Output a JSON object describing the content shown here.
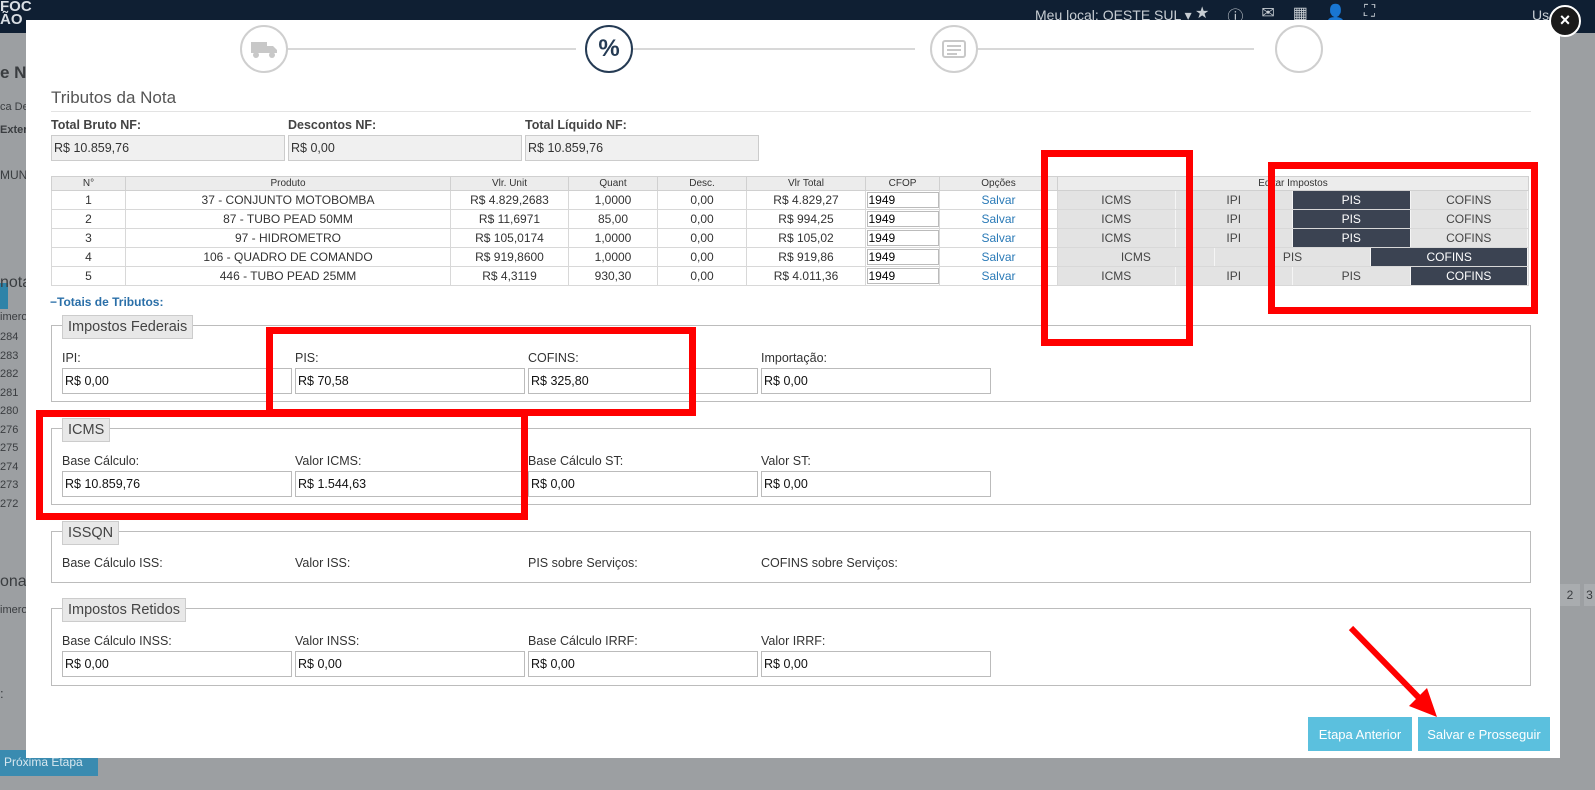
{
  "bg": {
    "logo_line1": "FOC",
    "logo_line2": "ÃO",
    "local": "Meu local: OESTE SUL",
    "user": "Us",
    "heading": "e N",
    "side1": "ca De",
    "side2": "Exter",
    "side3": "MUN",
    "side4": "nota",
    "col_header": "imero",
    "rows": [
      "284",
      "283",
      "282",
      "281",
      "280",
      "276",
      "275",
      "274",
      "273",
      "272"
    ],
    "section": "ona",
    "col_header2": "imero",
    "colon": ":",
    "next_step": "Próxima Etapa",
    "page2": "2",
    "page3": "3"
  },
  "modal": {
    "title": "Tributos da Nota",
    "total_bruto_label": "Total Bruto NF:",
    "total_bruto": "R$ 10.859,76",
    "descontos_label": "Descontos NF:",
    "descontos": "R$ 0,00",
    "total_liquido_label": "Total Líquido NF:",
    "total_liquido": "R$ 10.859,76",
    "table": {
      "headers": [
        "N°",
        "Produto",
        "Vlr. Unit",
        "Quant",
        "Desc.",
        "Vlr Total",
        "CFOP",
        "Opções",
        "Editar Impostos"
      ],
      "rows": [
        {
          "n": "1",
          "produto": "37 - CONJUNTO MOTOBOMBA",
          "unit": "R$ 4.829,2683",
          "quant": "1,0000",
          "desc": "0,00",
          "total": "R$ 4.829,27",
          "cfop": "1949",
          "opcao": "Salvar"
        },
        {
          "n": "2",
          "produto": "87 - TUBO PEAD 50MM",
          "unit": "R$ 11,6971",
          "quant": "85,00",
          "desc": "0,00",
          "total": "R$ 994,25",
          "cfop": "1949",
          "opcao": "Salvar"
        },
        {
          "n": "3",
          "produto": "97 - HIDROMETRO",
          "unit": "R$ 105,0174",
          "quant": "1,0000",
          "desc": "0,00",
          "total": "R$ 105,02",
          "cfop": "1949",
          "opcao": "Salvar"
        },
        {
          "n": "4",
          "produto": "106 - QUADRO DE COMANDO",
          "unit": "R$ 919,8600",
          "quant": "1,0000",
          "desc": "0,00",
          "total": "R$ 919,86",
          "cfop": "1949",
          "opcao": "Salvar"
        },
        {
          "n": "5",
          "produto": "446 - TUBO PEAD 25MM",
          "unit": "R$ 4,3119",
          "quant": "930,30",
          "desc": "0,00",
          "total": "R$ 4.011,36",
          "cfop": "1949",
          "opcao": "Salvar"
        }
      ],
      "tax_icms": "ICMS",
      "tax_ipi": "IPI",
      "tax_pis": "PIS",
      "tax_cofins": "COFINS"
    },
    "totais_title": "Totais de Tributos:",
    "federais": {
      "legend": "Impostos Federais",
      "ipi_label": "IPI:",
      "ipi": "R$ 0,00",
      "pis_label": "PIS:",
      "pis": "R$ 70,58",
      "cofins_label": "COFINS:",
      "cofins": "R$ 325,80",
      "importacao_label": "Importação:",
      "importacao": "R$ 0,00"
    },
    "icms": {
      "legend": "ICMS",
      "base_label": "Base Cálculo:",
      "base": "R$ 10.859,76",
      "valor_label": "Valor ICMS:",
      "valor": "R$ 1.544,63",
      "base_st_label": "Base Cálculo ST:",
      "base_st": "R$ 0,00",
      "valor_st_label": "Valor ST:",
      "valor_st": "R$ 0,00"
    },
    "issqn": {
      "legend": "ISSQN",
      "base_label": "Base Cálculo ISS:",
      "valor_label": "Valor ISS:",
      "pis_label": "PIS sobre Serviços:",
      "cofins_label": "COFINS sobre Serviços:"
    },
    "retidos": {
      "legend": "Impostos Retidos",
      "base_inss_label": "Base Cálculo INSS:",
      "base_inss": "R$ 0,00",
      "valor_inss_label": "Valor INSS:",
      "valor_inss": "R$ 0,00",
      "base_irrf_label": "Base Cálculo IRRF:",
      "base_irrf": "R$ 0,00",
      "valor_irrf_label": "Valor IRRF:",
      "valor_irrf": "R$ 0,00"
    },
    "btn_prev": "Etapa Anterior",
    "btn_next": "Salvar e Prosseguir",
    "close": "×"
  },
  "colors": {
    "topbar": "#0f1f33",
    "active_tax": "#3b4352",
    "button": "#5bc0de",
    "highlight": "#ff0000",
    "link": "#2a7ab7"
  }
}
